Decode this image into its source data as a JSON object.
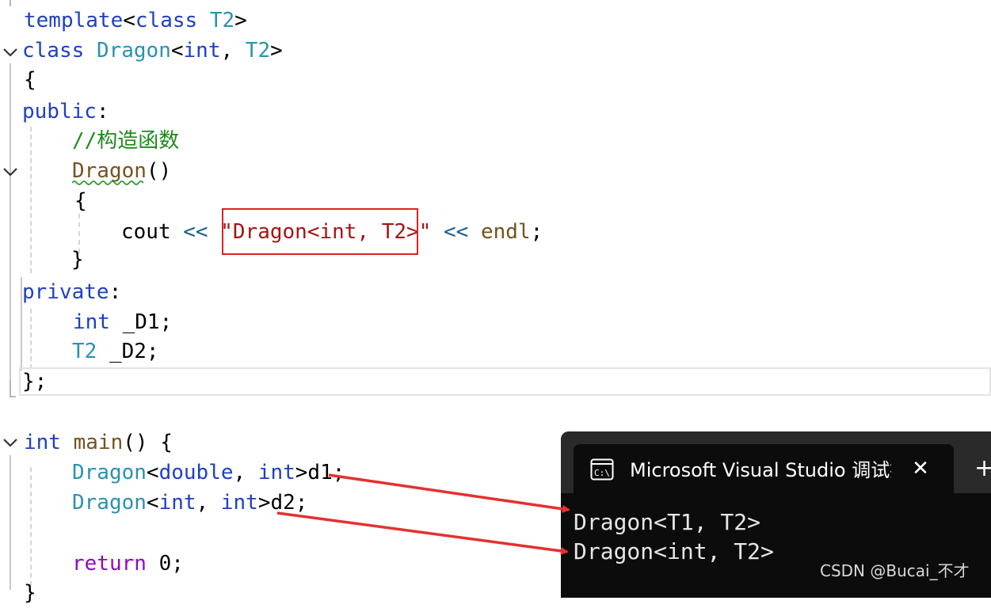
{
  "code": {
    "l1": {
      "kw1": "template",
      "p1": "<",
      "kw2": "class",
      "sp": " ",
      "t": "T2",
      "p2": ">"
    },
    "l2": {
      "kw": "class",
      "sp": " ",
      "name": "Dragon",
      "p1": "<",
      "kw2": "int",
      "p2": ", ",
      "t": "T2",
      "p3": ">"
    },
    "l3": {
      "brace": "{"
    },
    "l4": {
      "kw": "public",
      "p": ":"
    },
    "l5": {
      "comment": "//构造函数"
    },
    "l6": {
      "fn": "Dragon",
      "p": "()"
    },
    "l7": {
      "brace": "{"
    },
    "l8": {
      "cout": "cout",
      "op1": " << ",
      "str": "\"Dragon<int, T2>\"",
      "op2": " << ",
      "endl": "endl",
      "semi": ";"
    },
    "l9": {
      "brace": "}"
    },
    "l10": {
      "kw": "private",
      "p": ":"
    },
    "l11": {
      "kw": "int",
      "rest": " _D1;"
    },
    "l12": {
      "t": "T2",
      "rest": " _D2;"
    },
    "l13": {
      "text": "};"
    },
    "l14": {
      "kw": "int",
      "sp": " ",
      "fn": "main",
      "rest": "() {"
    },
    "l15": {
      "t": "Dragon",
      "p1": "<",
      "kw1": "double",
      "p2": ", ",
      "kw2": "int",
      "p3": ">d1;"
    },
    "l16": {
      "t": "Dragon",
      "p1": "<",
      "kw1": "int",
      "p2": ", ",
      "kw2": "int",
      "p3": ">d2;"
    },
    "l17": {
      "kw": "return",
      "rest": " 0;"
    },
    "l18": {
      "brace": "}"
    }
  },
  "console": {
    "title": "Microsoft Visual Studio 调试控制台",
    "close": "✕",
    "new_tab": "+",
    "output": [
      "Dragon<T1, T2>",
      "Dragon<int, T2>"
    ]
  },
  "watermark": "CSDN @Bucai_不才",
  "colors": {
    "keyword": "#1f3fc4",
    "type": "#2b91af",
    "string": "#a31515",
    "comment": "#1e8a1e",
    "annotation": "#e02020"
  }
}
